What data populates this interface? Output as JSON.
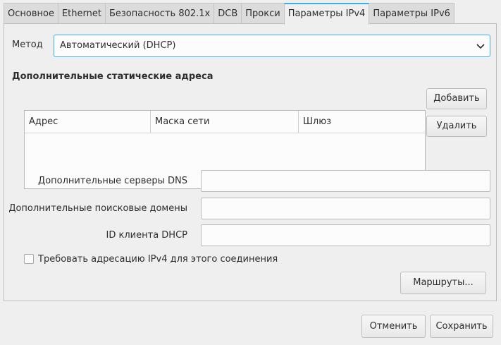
{
  "tabs": [
    "Основное",
    "Ethernet",
    "Безопасность 802.1x",
    "DCB",
    "Прокси",
    "Параметры IPv4",
    "Параметры IPv6"
  ],
  "active_tab_index": 5,
  "method": {
    "label": "Метод",
    "value": "Автоматический (DHCP)"
  },
  "static_section": {
    "title": "Дополнительные статические адреса"
  },
  "table": {
    "columns": [
      "Адрес",
      "Маска сети",
      "Шлюз"
    ],
    "rows": []
  },
  "buttons": {
    "add": "Добавить",
    "remove": "Удалить",
    "routes": "Маршруты...",
    "cancel": "Отменить",
    "save": "Сохранить"
  },
  "fields": {
    "dns_label": "Дополнительные серверы DNS",
    "dns_value": "",
    "domains_label": "Дополнительные поисковые домены",
    "domains_value": "",
    "dhcp_id_label": "ID клиента DHCP",
    "dhcp_id_value": ""
  },
  "require_ipv4": {
    "label": "Требовать адресацию IPv4 для этого соединения",
    "checked": false
  },
  "colors": {
    "accent": "#3daee9"
  }
}
